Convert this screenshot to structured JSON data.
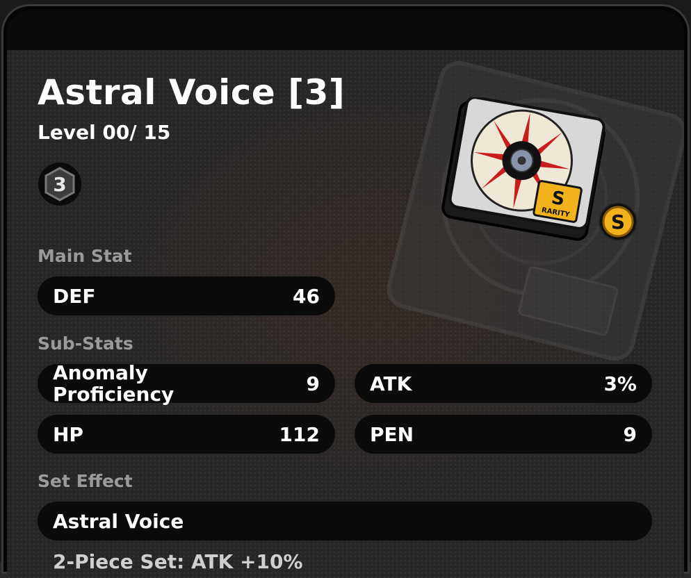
{
  "disc": {
    "title": "Astral Voice [3]",
    "level": "Level 00/ 15",
    "slot_badge": "3",
    "rarity_rank": "S",
    "rarity_label": "RARITY"
  },
  "main_stat": {
    "section_label": "Main Stat",
    "name": "DEF",
    "value": "46"
  },
  "sub_stats": {
    "section_label": "Sub-Stats",
    "items": [
      {
        "name": "Anomaly Proficiency",
        "value": "9"
      },
      {
        "name": "ATK",
        "value": "3%"
      },
      {
        "name": "HP",
        "value": "112"
      },
      {
        "name": "PEN",
        "value": "9"
      }
    ]
  },
  "set_effect": {
    "section_label": "Set Effect",
    "name": "Astral Voice",
    "description": "2-Piece Set: ATK +10%"
  },
  "colors": {
    "rank_gold": "#f2b21b",
    "row_bg": "#0b0b0b",
    "label_gray": "#9a9a9a"
  }
}
